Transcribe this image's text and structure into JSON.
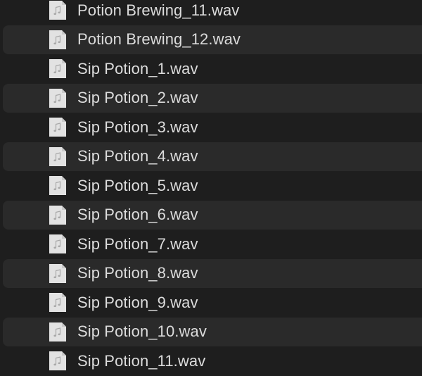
{
  "files": [
    {
      "name": "Potion Brewing_11.wav",
      "icon": "audio-file-icon"
    },
    {
      "name": "Potion Brewing_12.wav",
      "icon": "audio-file-icon"
    },
    {
      "name": "Sip Potion_1.wav",
      "icon": "audio-file-icon"
    },
    {
      "name": "Sip Potion_2.wav",
      "icon": "audio-file-icon"
    },
    {
      "name": "Sip Potion_3.wav",
      "icon": "audio-file-icon"
    },
    {
      "name": "Sip Potion_4.wav",
      "icon": "audio-file-icon"
    },
    {
      "name": "Sip Potion_5.wav",
      "icon": "audio-file-icon"
    },
    {
      "name": "Sip Potion_6.wav",
      "icon": "audio-file-icon"
    },
    {
      "name": "Sip Potion_7.wav",
      "icon": "audio-file-icon"
    },
    {
      "name": "Sip Potion_8.wav",
      "icon": "audio-file-icon"
    },
    {
      "name": "Sip Potion_9.wav",
      "icon": "audio-file-icon"
    },
    {
      "name": "Sip Potion_10.wav",
      "icon": "audio-file-icon"
    },
    {
      "name": "Sip Potion_11.wav",
      "icon": "audio-file-icon"
    }
  ],
  "colors": {
    "background": "#1e1e1e",
    "alternate_row": "#2a2a2a",
    "text": "#dcdcdc",
    "icon_page": "#e2e2e2",
    "icon_glyph": "#a8a8a8"
  }
}
